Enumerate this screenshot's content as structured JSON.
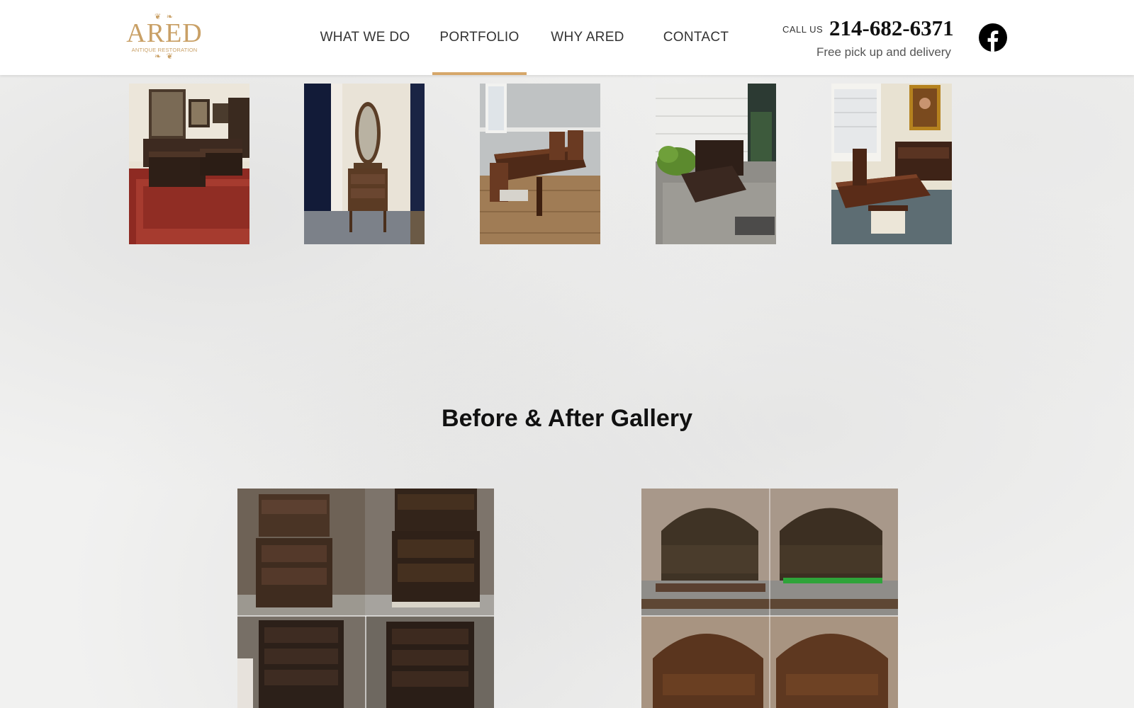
{
  "header": {
    "logo": {
      "text": "ARED",
      "subtitle": "ANTIQUE RESTORATION"
    },
    "nav": [
      {
        "label": "WHAT WE DO",
        "active": false
      },
      {
        "label": "PORTFOLIO",
        "active": true
      },
      {
        "label": "WHY ARED",
        "active": false
      },
      {
        "label": "CONTACT",
        "active": false
      }
    ],
    "call_label": "CALL US",
    "phone": "214-682-6371",
    "delivery": "Free pick up and delivery",
    "social_icon": "facebook-icon"
  },
  "portfolio": {
    "thumbnails": [
      {
        "icon": "photo-leather-sofa-living-room"
      },
      {
        "icon": "photo-dresser-with-mirror"
      },
      {
        "icon": "photo-dining-table-chairs"
      },
      {
        "icon": "photo-cabinet-porch"
      },
      {
        "icon": "photo-dining-room-buffet"
      }
    ]
  },
  "gallery": {
    "title": "Before & After Gallery",
    "items": [
      {
        "icon": "photo-chest-of-drawers-before-after"
      },
      {
        "icon": "photo-bed-frame-before-after"
      }
    ]
  },
  "colors": {
    "accent": "#d6a76a",
    "logo": "#c9a066",
    "header_bg": "#ffffff",
    "page_bg": "#f1f1f0"
  }
}
